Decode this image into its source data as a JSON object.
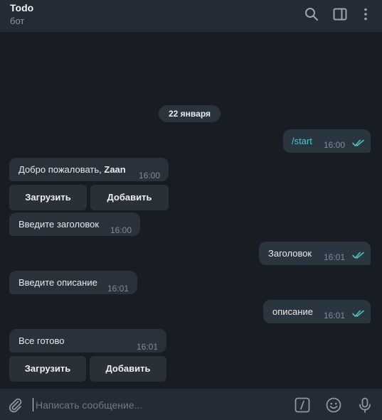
{
  "header": {
    "title": "Todo",
    "subtitle": "бот",
    "icons": [
      "search-icon",
      "sidebar-toggle-icon",
      "more-vertical-icon"
    ]
  },
  "chat": {
    "date": "22 января",
    "messages": [
      {
        "dir": "out",
        "text": "/start",
        "time": "16:00",
        "read": true
      },
      {
        "dir": "in",
        "text_prefix": "Добро пожаловать, ",
        "text_bold": "Zaan",
        "time": "16:00"
      },
      {
        "dir": "in",
        "text": "Введите заголовок",
        "time": "16:00"
      },
      {
        "dir": "out",
        "text": "Заголовок",
        "time": "16:01",
        "read": true
      },
      {
        "dir": "in",
        "text": "Введите описание",
        "time": "16:01"
      },
      {
        "dir": "out",
        "text": "описание",
        "time": "16:01",
        "read": true
      },
      {
        "dir": "in",
        "text": "Все готово",
        "time": "16:01"
      }
    ],
    "keyboard1": {
      "upload": "Загрузить",
      "add": "Добавить"
    },
    "keyboard2": {
      "upload": "Загрузить",
      "add": "Добавить"
    }
  },
  "footer": {
    "placeholder": "Написать сообщение...",
    "value": "",
    "icons": [
      "attach-icon",
      "bot-commands-icon",
      "emoji-icon",
      "microphone-icon"
    ]
  },
  "colors": {
    "header_bg": "#232b35",
    "chat_bg": "#181d23",
    "incoming_bubble": "#2b313a",
    "outgoing_bubble": "#2b3540",
    "command_link": "#4fc3c9",
    "read_ticks": "#4fc3b8"
  }
}
